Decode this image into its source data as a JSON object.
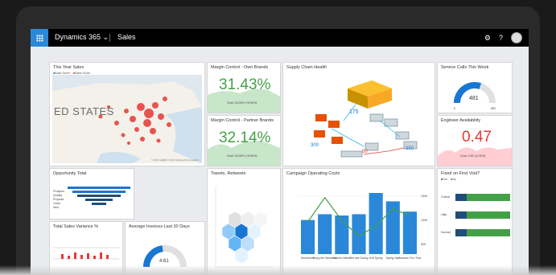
{
  "app": {
    "name": "Dynamics 365",
    "chevron": "⌄",
    "area": "Sales",
    "settings_glyph": "⚙",
    "help_glyph": "?"
  },
  "tiles": {
    "sales": {
      "title": "This Year Sales",
      "legend": [
        "Base Score",
        "Sales Score"
      ],
      "map_label": "ED STATES",
      "footer": "© 2016 HERE  © 2016 Microsoft Corporation"
    },
    "margin_own": {
      "title": "Margin Control - Own Brands",
      "value": "31.43%",
      "caption": "Goal: 33.00% (+6.90%)"
    },
    "margin_partner": {
      "title": "Margin Control - Partner Brands",
      "value": "32.14%",
      "caption": "Goal: 33.00% (+6.90%)"
    },
    "supply": {
      "title": "Supply Chain Health",
      "values": [
        "175",
        "300",
        "50",
        "350"
      ]
    },
    "service": {
      "title": "Service Calls This Week",
      "value": "481",
      "min": "0",
      "max": "800",
      "fraction": 0.6
    },
    "engineer": {
      "title": "Engineer Availability",
      "value": "0.47",
      "caption": "Goal: 0.50 (-6.00%)"
    },
    "opportunity": {
      "title": "Opportunity Total",
      "categories": [
        "Prospect",
        "Qualify",
        "Propose",
        "Close",
        "Won"
      ]
    },
    "tweets": {
      "title": "Tweets, Retweets"
    },
    "campaign": {
      "title": "Campaign Operating Costs",
      "categories": [
        "Brickwinter",
        "Enjoy the Weekend",
        "Fashion Winter",
        "Get with Dialog",
        "Soft Spring",
        "Spring Sale",
        "Summer Fun Time"
      ],
      "bars": [
        53,
        62,
        60,
        62,
        95,
        82,
        66
      ],
      "line": [
        50,
        88,
        52,
        28,
        44,
        70,
        60
      ],
      "y_labels": [
        "150K",
        "100K",
        "50K"
      ]
    },
    "fixed": {
      "title": "Fixed on First Visit?",
      "legend": [
        "Yes",
        "No"
      ],
      "rows": [
        {
          "label": "Critical",
          "yes": 20,
          "no": 80
        },
        {
          "label": "High",
          "yes": 20,
          "no": 80
        },
        {
          "label": "Normal",
          "yes": 20,
          "no": 80
        }
      ]
    },
    "variance": {
      "title": "Total Sales Variance %"
    },
    "invoices": {
      "title": "Average Invoices Last 30 Days",
      "value": "4.61",
      "fraction": 0.46
    }
  },
  "colors": {
    "accent": "#2b88d8",
    "green": "#43a047",
    "red": "#e53935",
    "navy": "#1f4e79"
  }
}
